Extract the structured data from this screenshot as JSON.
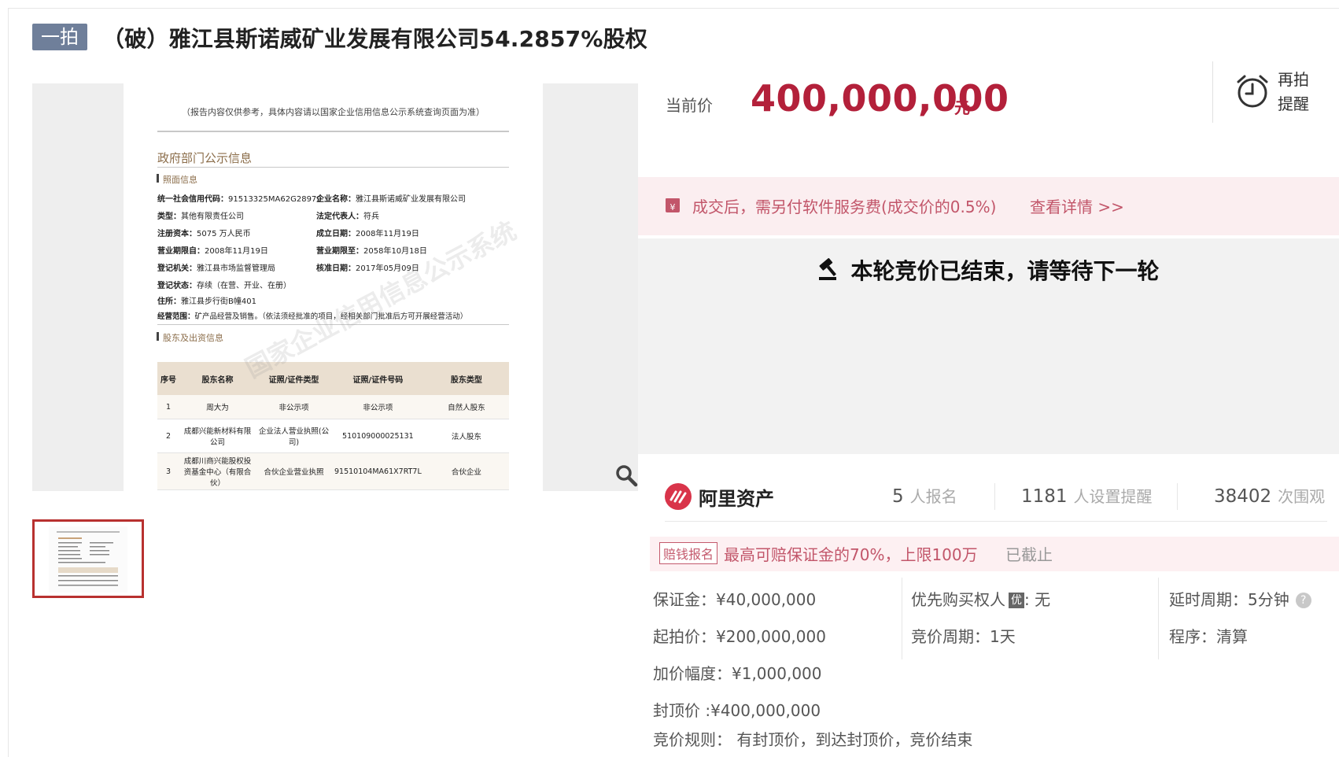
{
  "header": {
    "badge": "一拍",
    "title": "（破）雅江县斯诺威矿业发展有限公司54.2857%股权"
  },
  "document_image": {
    "note": "（报告内容仅供参考，具体内容请以国家企业信用信息公示系统查询页面为准）",
    "section_title": "政府部门公示信息",
    "subsection_1": "照面信息",
    "fields": [
      {
        "label": "统一社会信用代码：",
        "value": "91513325MA62G28979"
      },
      {
        "label": "企业名称：",
        "value": "雅江县斯诺威矿业发展有限公司"
      },
      {
        "label": "类型：",
        "value": "其他有限责任公司"
      },
      {
        "label": "法定代表人：",
        "value": "符兵"
      },
      {
        "label": "注册资本：",
        "value": "5075 万人民币"
      },
      {
        "label": "成立日期：",
        "value": "2008年11月19日"
      },
      {
        "label": "营业期限自：",
        "value": "2008年11月19日"
      },
      {
        "label": "营业期限至：",
        "value": "2058年10月18日"
      },
      {
        "label": "登记机关：",
        "value": "雅江县市场监督管理局"
      },
      {
        "label": "核准日期：",
        "value": "2017年05月09日"
      },
      {
        "label": "登记状态：",
        "value": "存续（在营、开业、在册）"
      },
      {
        "label": "住所：",
        "value": "雅江县步行街B幢401"
      },
      {
        "label": "经营范围：",
        "value": "矿产品经营及销售。（依法须经批准的项目，经相关部门批准后方可开展经营活动）"
      }
    ],
    "subsection_2": "股东及出资信息",
    "table_headers": [
      "序号",
      "股东名称",
      "证照/证件类型",
      "证照/证件号码",
      "股东类型"
    ],
    "table_rows": [
      [
        "1",
        "周大为",
        "非公示项",
        "非公示项",
        "自然人股东"
      ],
      [
        "2",
        "成都兴能新材料有限公司",
        "企业法人营业执照(公司)",
        "510109000025131",
        "法人股东"
      ],
      [
        "3",
        "成都川商兴能股权投资基金中心（有限合伙）",
        "合伙企业营业执照",
        "91510104MA61X7RT7L",
        "合伙企业"
      ]
    ],
    "watermark": "国家企业信用信息公示系统"
  },
  "price": {
    "label": "当前价",
    "value": "400,000,000",
    "unit": "元"
  },
  "reminder": {
    "line1": "再拍",
    "line2": "提醒"
  },
  "fee_notice": {
    "text": "成交后，需另付软件服务费(成交价的0.5%)",
    "link": "查看详情 >>"
  },
  "status_message": "本轮竞价已结束，请等待下一轮",
  "platform": {
    "name": "阿里资产"
  },
  "stats": [
    {
      "num": "5",
      "label": "人报名"
    },
    {
      "num": "1181",
      "label": "人设置提醒"
    },
    {
      "num": "38402",
      "label": "次围观"
    }
  ],
  "compensation": {
    "tag": "赔钱报名",
    "text": "最高可赔保证金的70%，上限100万",
    "status": "已截止"
  },
  "details": {
    "deposit": "保证金：¥40,000,000",
    "start_price": "起拍价：¥200,000,000",
    "increment": "加价幅度：¥1,000,000",
    "cap_price": "封顶价 :¥400,000,000",
    "rule": "竞价规则：  有封顶价，到达封顶价，竞价结束",
    "priority_label": "优先购买权人",
    "priority_badge": "优",
    "priority_value": ": 无",
    "cycle": "竞价周期：1天",
    "delay": "延时周期：5分钟",
    "help": "?",
    "procedure": "程序：清算"
  },
  "colors": {
    "accent": "#b3203a",
    "badge": "#6f7f9a",
    "notice_bg": "#fbeef0",
    "notice_text": "#c2566a"
  }
}
